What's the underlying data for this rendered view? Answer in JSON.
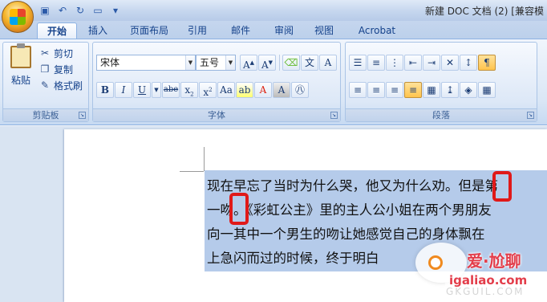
{
  "titlebar": {
    "title": "新建 DOC 文档 (2) [兼容模"
  },
  "tabs": [
    "开始",
    "插入",
    "页面布局",
    "引用",
    "邮件",
    "审阅",
    "视图",
    "Acrobat"
  ],
  "clipboard": {
    "paste": "粘贴",
    "cut": "剪切",
    "copy": "复制",
    "format_painter": "格式刷",
    "label": "剪贴板"
  },
  "font": {
    "name": "宋体",
    "size": "五号",
    "label": "字体"
  },
  "paragraph": {
    "label": "段落"
  },
  "document": {
    "lines": [
      "现在早忘了当时为什么哭，他又为什么劝。但是第",
      "一吻。《彩虹公主》里的主人公小姐在两个男朋友",
      "向一其中一个男生的吻让她感觉自己的身体飘在",
      "上急闪而过的时候，终于明白"
    ]
  },
  "watermark": {
    "brand": "爱·尬聊",
    "site": "igaliao.com",
    "faint": "GKGUIL.COM"
  },
  "colors": {
    "accent": "#15428b",
    "highlight": "#b5cbea",
    "mark": "#e01919"
  }
}
